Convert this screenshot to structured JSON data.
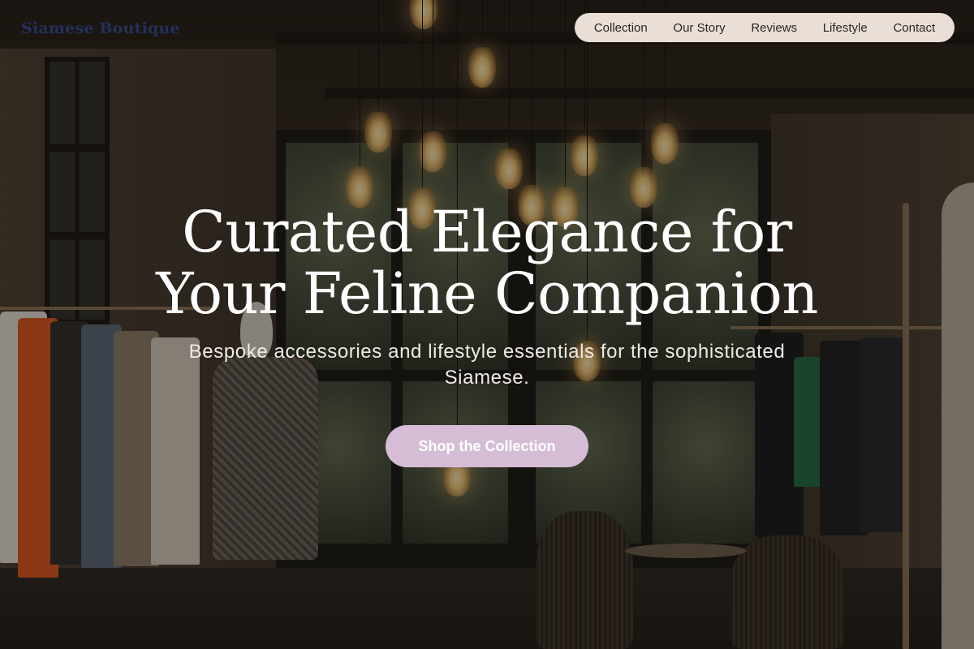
{
  "header": {
    "brand": "Siamese Boutique",
    "nav": [
      "Collection",
      "Our Story",
      "Reviews",
      "Lifestyle",
      "Contact"
    ]
  },
  "hero": {
    "title": "Curated Elegance for Your Feline Companion",
    "subtitle": "Bespoke accessories and lifestyle essentials for the sophisticated Siamese.",
    "cta_label": "Shop the Collection"
  },
  "colors": {
    "nav_background": "#e9dfd6",
    "brand_text": "#22305a",
    "cta_background": "#d5bdd5",
    "overlay": "#120e0a"
  }
}
